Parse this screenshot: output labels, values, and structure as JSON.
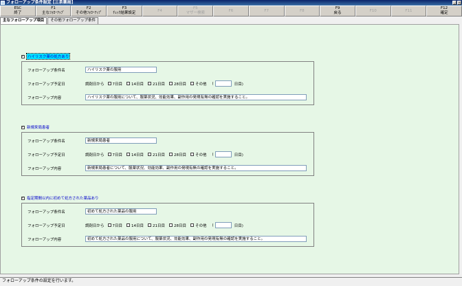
{
  "window": {
    "title": "フォローアップ条件設定 [三茶薬局]",
    "min": "_",
    "close": "×"
  },
  "fkeys": [
    {
      "key": "ESC",
      "label": "終了",
      "enabled": true
    },
    {
      "key": "F1",
      "label": "主なﾌｫﾛｰｱｯﾌﾟ",
      "enabled": true
    },
    {
      "key": "F2",
      "label": "その他ﾌｫﾛｰｱｯﾌﾟ",
      "enabled": true
    },
    {
      "key": "F3",
      "label": "ﾁｪｯｸ結果設定",
      "enabled": true
    },
    {
      "key": "F4",
      "label": "",
      "enabled": false
    },
    {
      "key": "F5",
      "label": "マザー検索",
      "enabled": false
    },
    {
      "key": "F6",
      "label": "",
      "enabled": false
    },
    {
      "key": "F7",
      "label": "",
      "enabled": false
    },
    {
      "key": "F8",
      "label": "",
      "enabled": false
    },
    {
      "key": "F9",
      "label": "戻る",
      "enabled": true
    },
    {
      "key": "F10",
      "label": "",
      "enabled": false
    },
    {
      "key": "F11",
      "label": "",
      "enabled": false
    },
    {
      "key": "F12",
      "label": "確定",
      "enabled": true
    }
  ],
  "tabs": [
    {
      "label": "主なフォローアップ項目",
      "active": true
    },
    {
      "label": "その他フォローアップ条件",
      "active": false
    }
  ],
  "labels": {
    "condition_name": "フォローアップ条件名",
    "schedule": "フォローアップ予定日",
    "content": "フォローアップ内容",
    "from_visit": "調剤日から",
    "open_paren": "(",
    "day_suffix": "日目)",
    "check_mark": "✓"
  },
  "day_options": [
    "7日目",
    "14日目",
    "21日目",
    "28日目",
    "その他"
  ],
  "sections": [
    {
      "title": "ハイリスク薬の処方あり",
      "checked": true,
      "highlight": true,
      "name": "ハイリスク薬の服用",
      "content": "ハイリスク薬の服用について、服薬状況、効能効果、副作用の発現有無の確認を実施すること。"
    },
    {
      "title": "新規来局患者",
      "checked": true,
      "highlight": false,
      "name": "新規来局患者",
      "content": "新規来局患者について、服薬状況、効能効果、副作用の発現有無の確認を実施すること。"
    },
    {
      "title": "指定期間以内に初めて処方された薬品あり",
      "checked": true,
      "highlight": false,
      "name": "初めて処方された薬品の服用",
      "content": "初めて処方された薬品の服用について、服薬状況、効能効果、副作用の発現有無の確認を実施すること。"
    }
  ],
  "status": {
    "message": "フォローアップ条件の設定を行います。"
  }
}
